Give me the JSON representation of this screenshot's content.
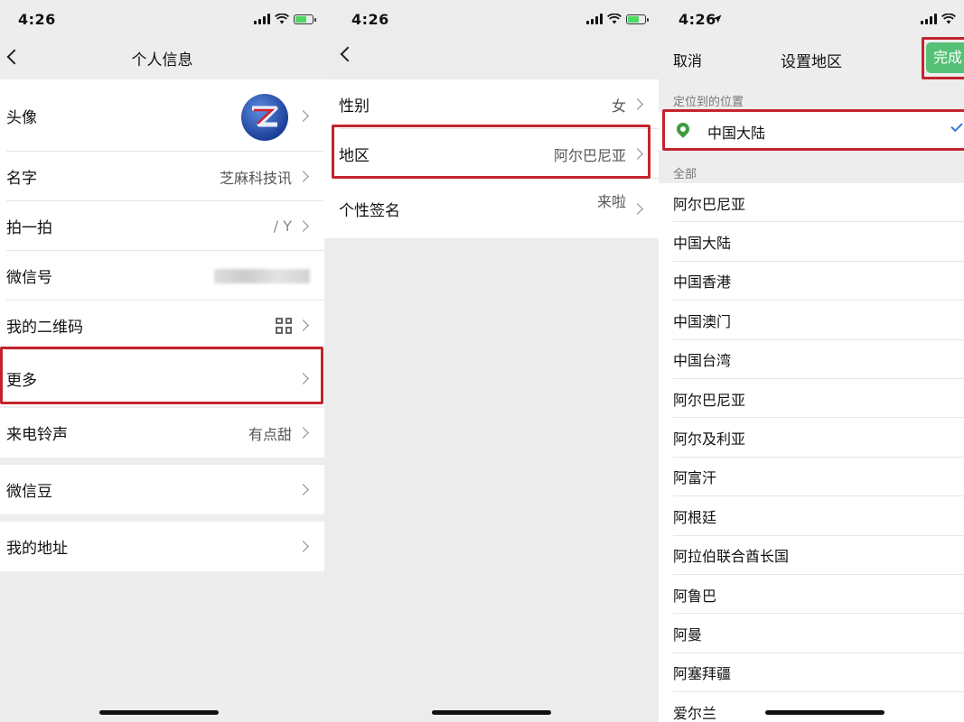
{
  "screen1": {
    "time": "4:26",
    "title": "个人信息",
    "rows": [
      {
        "label": "头像"
      },
      {
        "label": "名字",
        "value": "芝麻科技讯"
      },
      {
        "label": "拍一拍",
        "value": "/ Y"
      },
      {
        "label": "微信号"
      },
      {
        "label": "我的二维码"
      },
      {
        "label": "更多"
      },
      {
        "label": "来电铃声",
        "value": "有点甜"
      },
      {
        "label": "微信豆"
      },
      {
        "label": "我的地址"
      }
    ]
  },
  "screen2": {
    "time": "4:26",
    "rows": [
      {
        "label": "性别",
        "value": "女"
      },
      {
        "label": "地区",
        "value": "阿尔巴尼亚"
      },
      {
        "label": "个性签名",
        "value": "来啦"
      }
    ]
  },
  "screen3": {
    "time": "4:26",
    "cancel": "取消",
    "title": "设置地区",
    "done": "完成",
    "located_label": "定位到的位置",
    "located_value": "中国大陆",
    "all_label": "全部",
    "regions": [
      "阿尔巴尼亚",
      "中国大陆",
      "中国香港",
      "中国澳门",
      "中国台湾",
      "阿尔巴尼亚",
      "阿尔及利亚",
      "阿富汗",
      "阿根廷",
      "阿拉伯联合酋长国",
      "阿鲁巴",
      "阿曼",
      "阿塞拜疆",
      "爱尔兰"
    ]
  },
  "colors": {
    "highlight": "#c3232d",
    "done_button": "#55c177",
    "location_pin": "#3f9b3f",
    "battery": "#4cd964"
  },
  "icons": [
    "signal-icon",
    "wifi-icon",
    "battery-icon",
    "back-chevron-icon",
    "chevron-right-icon",
    "qr-code-icon",
    "location-pin-icon",
    "checkmark-icon",
    "location-arrow-icon"
  ]
}
